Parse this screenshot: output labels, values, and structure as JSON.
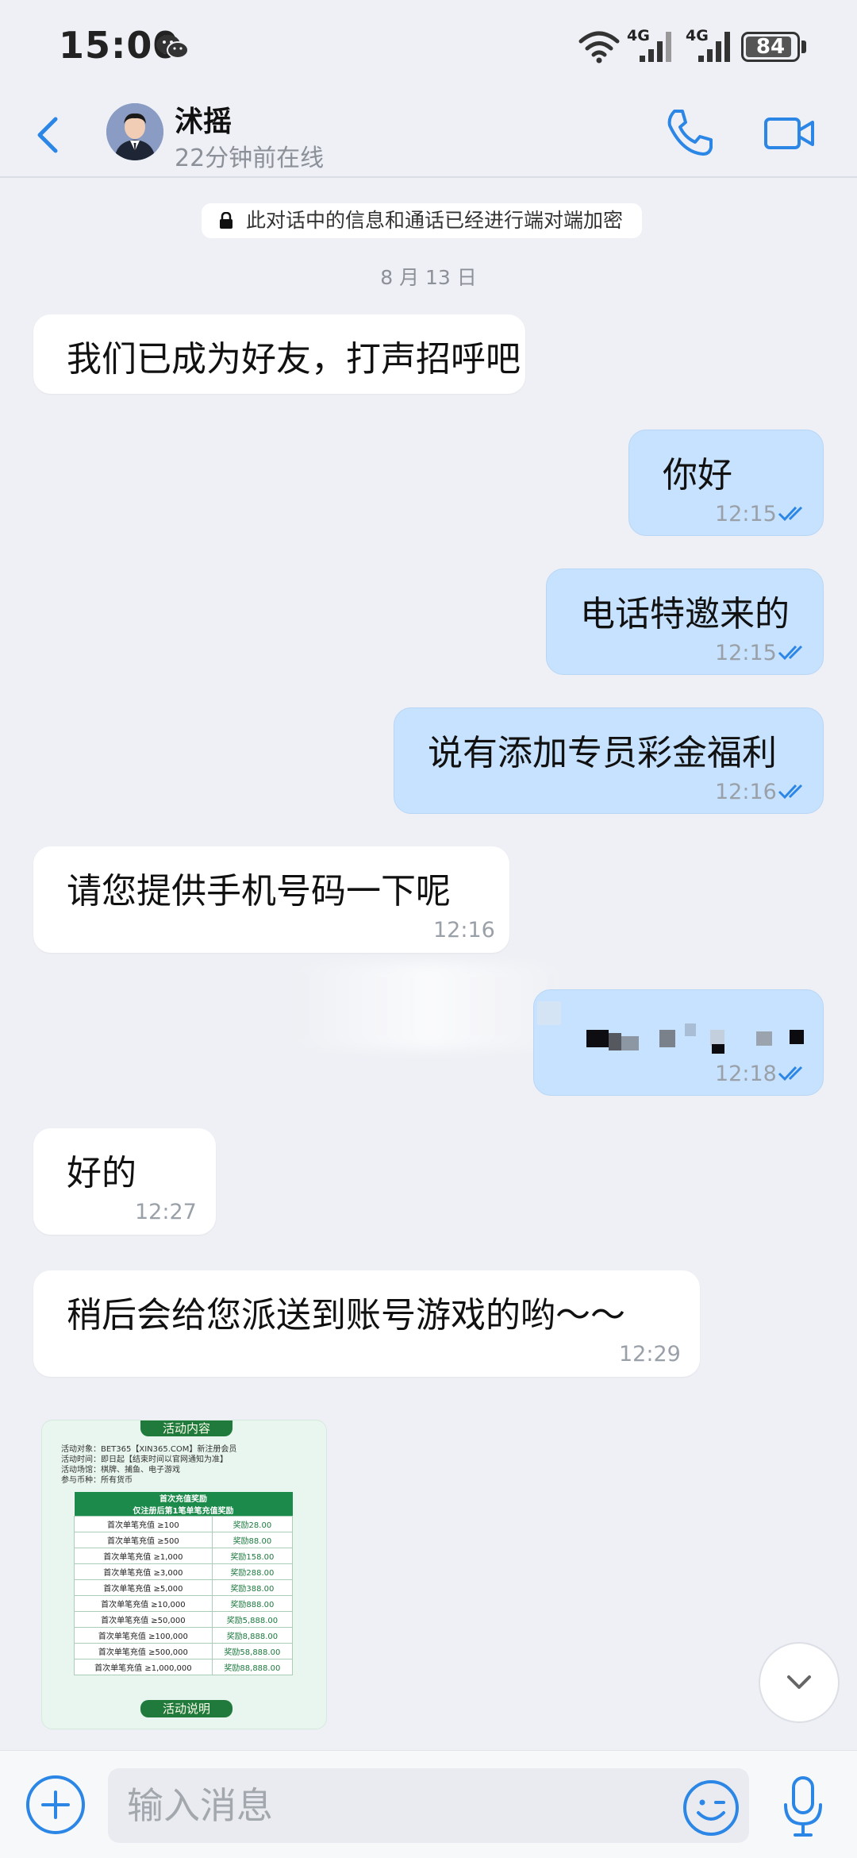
{
  "status_bar": {
    "time": "15:00",
    "network_1": "4G",
    "network_2": "4G",
    "battery": "84"
  },
  "header": {
    "contact_name": "沭摇",
    "contact_status": "22分钟前在线"
  },
  "chat": {
    "encryption_notice": "此对话中的信息和通话已经进行端对端加密",
    "date_separator": "8 月 13 日",
    "messages": [
      {
        "direction": "in",
        "text": "我们已成为好友，打声招呼吧",
        "time": ""
      },
      {
        "direction": "out",
        "text": "你好",
        "time": "12:15"
      },
      {
        "direction": "out",
        "text": "电话特邀来的",
        "time": "12:15"
      },
      {
        "direction": "out",
        "text": "说有添加专员彩金福利",
        "time": "12:16"
      },
      {
        "direction": "in",
        "text": "请您提供手机号码一下呢",
        "time": "12:16"
      },
      {
        "direction": "out",
        "text": "",
        "time": "12:18"
      },
      {
        "direction": "in",
        "text": "好的",
        "time": "12:27"
      },
      {
        "direction": "in",
        "text": "稍后会给您派送到账号游戏的哟～～",
        "time": "12:29"
      }
    ],
    "image_message": {
      "title": "活动内容",
      "info_lines": [
        "活动对象：BET365【XIN365.COM】新注册会员",
        "活动时间：即日起【结束时间以官网通知为准】",
        "活动场馆：棋牌、捕鱼、电子游戏",
        "参与币种：所有货币"
      ],
      "table_title_1": "首次充值奖励",
      "table_title_2": "仅注册后第1笔单笔充值奖励",
      "rows": [
        {
          "condition": "首次单笔充值 ≥100",
          "reward": "奖励28.00"
        },
        {
          "condition": "首次单笔充值 ≥500",
          "reward": "奖励88.00"
        },
        {
          "condition": "首次单笔充值 ≥1,000",
          "reward": "奖励158.00"
        },
        {
          "condition": "首次单笔充值 ≥3,000",
          "reward": "奖励288.00"
        },
        {
          "condition": "首次单笔充值 ≥5,000",
          "reward": "奖励388.00"
        },
        {
          "condition": "首次单笔充值 ≥10,000",
          "reward": "奖励888.00"
        },
        {
          "condition": "首次单笔充值 ≥50,000",
          "reward": "奖励5,888.00"
        },
        {
          "condition": "首次单笔充值 ≥100,000",
          "reward": "奖励8,888.00"
        },
        {
          "condition": "首次单笔充值 ≥500,000",
          "reward": "奖励58,888.00"
        },
        {
          "condition": "首次单笔充值 ≥1,000,000",
          "reward": "奖励88,888.00"
        }
      ],
      "footer_title": "活动说明"
    }
  },
  "input": {
    "placeholder": "输入消息"
  },
  "colors": {
    "accent": "#2b86e6",
    "outgoing_bubble": "#c7e2ff",
    "incoming_bubble": "#ffffff",
    "background": "#eef0f5"
  },
  "icons": [
    "wechat-icon",
    "wifi-icon",
    "signal-icon",
    "battery-icon",
    "back-icon",
    "phone-icon",
    "video-icon",
    "lock-icon",
    "double-check-icon",
    "chevron-down-icon",
    "plus-icon",
    "emoji-icon",
    "mic-icon"
  ]
}
